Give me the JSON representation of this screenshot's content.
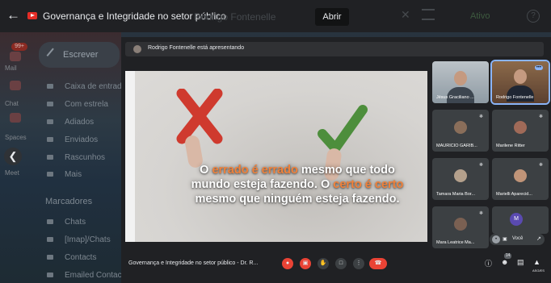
{
  "browser": {
    "tab_title": "Governança e Integridade no setor público",
    "open_button": "Abrir"
  },
  "background": {
    "search_placeholder": "Rodrigo Fontenelle",
    "status": "Ativo",
    "compose_label": "Escrever",
    "mail_badge": "99+",
    "rail_labels": [
      "Mail",
      "Chat",
      "Spaces",
      "Meet"
    ],
    "folders": [
      "Caixa de entrada",
      "Com estrela",
      "Adiados",
      "Enviados",
      "Rascunhos",
      "Mais"
    ],
    "labels_heading": "Marcadores",
    "labels": [
      "Chats",
      "[Imap]/Chats",
      "Contacts",
      "Emailed Contacts"
    ]
  },
  "meet": {
    "presenting_text": "Rodrigo Fontenelle está apresentando",
    "meeting_title": "Governança e Integridade no setor público - Dr. R...",
    "self_label": "Você",
    "self_initial": "M",
    "participants_badge": "14",
    "asg_label": "ASG/ES",
    "tiles": [
      {
        "name": "Jésus Graciliano ..."
      },
      {
        "name": "Rodrigo Fontenelle"
      },
      {
        "name": "MAURICIO GARIB..."
      },
      {
        "name": "Marilene Ritter"
      },
      {
        "name": "Tamara Maria Bor..."
      },
      {
        "name": "Marielli Aparecid..."
      },
      {
        "name": "Mara Leatrice Ma..."
      }
    ]
  },
  "slide": {
    "line1": [
      "O ",
      "errado é errado",
      " mesmo que ",
      "todo"
    ],
    "line2": [
      "mundo esteja fazendo",
      ". O ",
      "certo é certo"
    ],
    "line3": [
      "mesmo que ",
      "ninguém esteja fazendo",
      "."
    ]
  },
  "colors": {
    "accent_orange": "#f0813a",
    "danger_red": "#ea4335",
    "active_outline": "#8ab4f8"
  }
}
